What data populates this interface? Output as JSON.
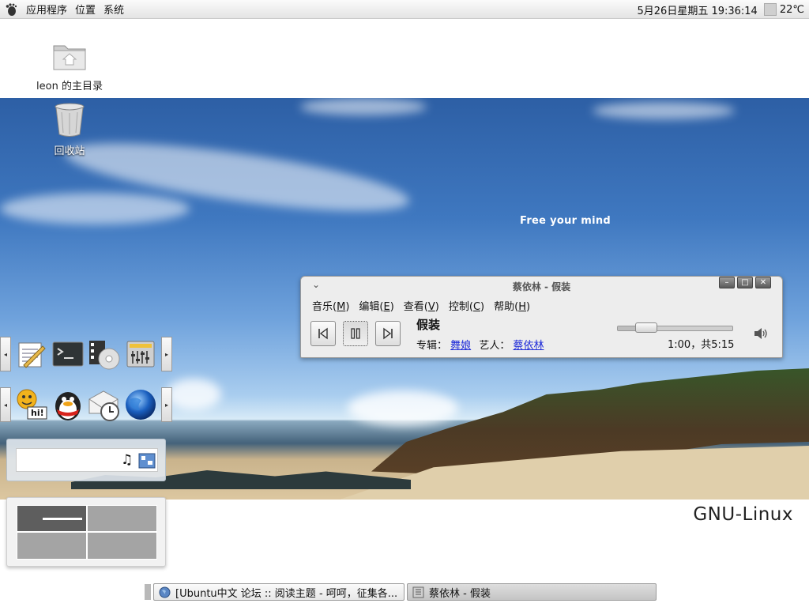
{
  "top_panel": {
    "menus": [
      "应用程序",
      "位置",
      "系统"
    ],
    "clock": "5月26日星期五 19:36:14",
    "temperature": "22℃"
  },
  "desktop": {
    "icons": [
      {
        "label": "leon 的主目录",
        "icon": "home-folder-icon"
      },
      {
        "label": "回收站",
        "icon": "trash-icon"
      }
    ],
    "tagline": "Free your mind",
    "watermark": "GNU-Linux"
  },
  "launchers": {
    "row1": [
      "text-editor-icon",
      "terminal-icon",
      "video-player-icon",
      "audio-mixer-icon"
    ],
    "row2": [
      "chat-messenger-icon",
      "qq-penguin-icon",
      "mail-clock-icon",
      "firefox-globe-icon"
    ],
    "hi_badge": "hi!"
  },
  "search_applet": {
    "value": ""
  },
  "workspaces": {
    "count": 4,
    "active": 0
  },
  "player": {
    "title": "蔡依林 - 假装",
    "menus": [
      {
        "label": "音乐",
        "key": "M"
      },
      {
        "label": "编辑",
        "key": "E"
      },
      {
        "label": "查看",
        "key": "V"
      },
      {
        "label": "控制",
        "key": "C"
      },
      {
        "label": "帮助",
        "key": "H"
      }
    ],
    "song": "假装",
    "album_label": "专辑：",
    "album": "舞娘",
    "artist_label": "艺人：",
    "artist": "蔡依林",
    "time": "1:00，共5:15",
    "progress": 0.19
  },
  "taskbar": {
    "tasks": [
      {
        "label": "[Ubuntu中文 论坛 :: 阅读主题 - 呵呵，征集各...",
        "icon": "globe-icon",
        "active": false
      },
      {
        "label": "蔡依林 - 假装",
        "icon": "player-icon",
        "active": true
      }
    ]
  },
  "colors": {
    "link": "#1e2bd8",
    "sky": "#3f78c0",
    "panel": "#e4e4e4"
  }
}
